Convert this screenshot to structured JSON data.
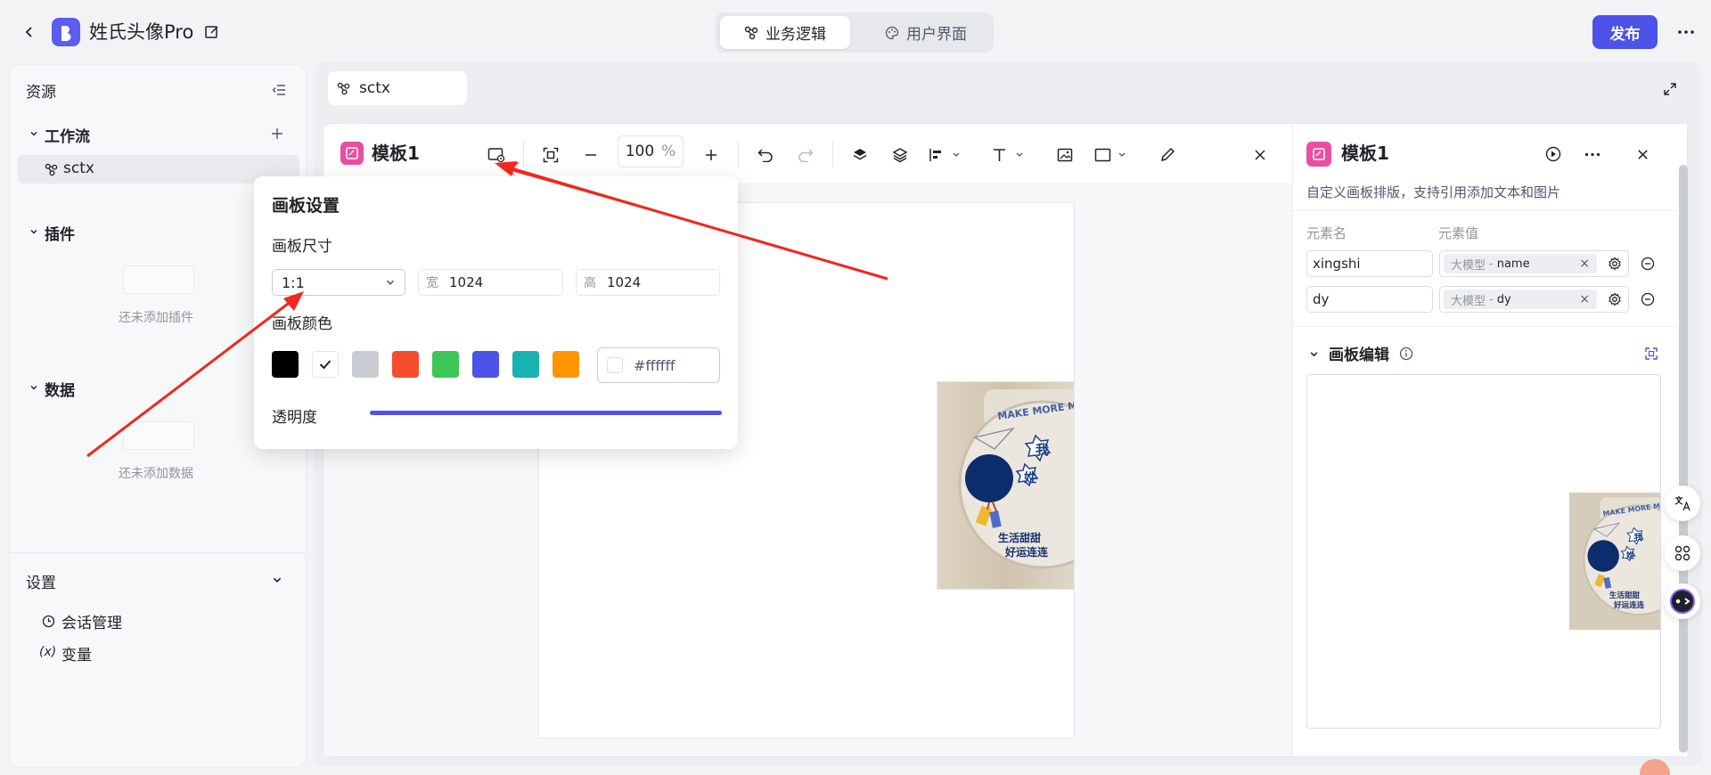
{
  "app": {
    "name": "姓氏头像Pro"
  },
  "mode_tabs": {
    "logic": "业务逻辑",
    "ui": "用户界面"
  },
  "publish_label": "发布",
  "sidebar": {
    "title": "资源",
    "workflow": {
      "label": "工作流",
      "items": [
        "sctx"
      ]
    },
    "plugins": {
      "label": "插件",
      "empty": "还未添加插件"
    },
    "data": {
      "label": "数据",
      "empty": "还未添加数据"
    },
    "settings": {
      "label": "设置",
      "items": [
        "会话管理",
        "变量"
      ]
    }
  },
  "file_tab": "sctx",
  "editor": {
    "title": "模板1",
    "zoom": "100",
    "zoom_unit": "%"
  },
  "popover": {
    "title": "画板设置",
    "size_label": "画板尺寸",
    "ratio": "1:1",
    "width_label": "宽",
    "width": "1024",
    "height_label": "高",
    "height": "1024",
    "color_label": "画板颜色",
    "swatches": [
      "#000000",
      "#ffffff",
      "#c9ccd2",
      "#f44d2d",
      "#3dc657",
      "#4d53e8",
      "#18b2b0",
      "#ff9500"
    ],
    "selected_swatch": "#ffffff",
    "hex": "#ffffff",
    "opacity_label": "透明度",
    "opacity": 1.0
  },
  "canvas_image": {
    "arc_text": "MAKE MORE MO",
    "tag1": "我",
    "tag2": "姓",
    "line1": "生活甜甜",
    "line2": "好运连连"
  },
  "right_panel": {
    "title": "模板1",
    "description": "自定义画板排版，支持引用添加文本和图片",
    "col_name": "元素名",
    "col_value": "元素值",
    "rows": [
      {
        "name": "xingshi",
        "src": "大模型",
        "sep": "-",
        "field": "name"
      },
      {
        "name": "dy",
        "src": "大模型",
        "sep": "-",
        "field": "dy"
      }
    ],
    "section_title": "画板编辑",
    "preview_image": {
      "arc_text": "MAKE MORE MO",
      "tag1": "我",
      "tag2": "姓",
      "line1": "生活甜甜",
      "line2": "好运连连"
    }
  },
  "colors": {
    "accent": "#4d53e8",
    "brand_pink": "#e94fa0",
    "arrow": "#f0281e"
  }
}
